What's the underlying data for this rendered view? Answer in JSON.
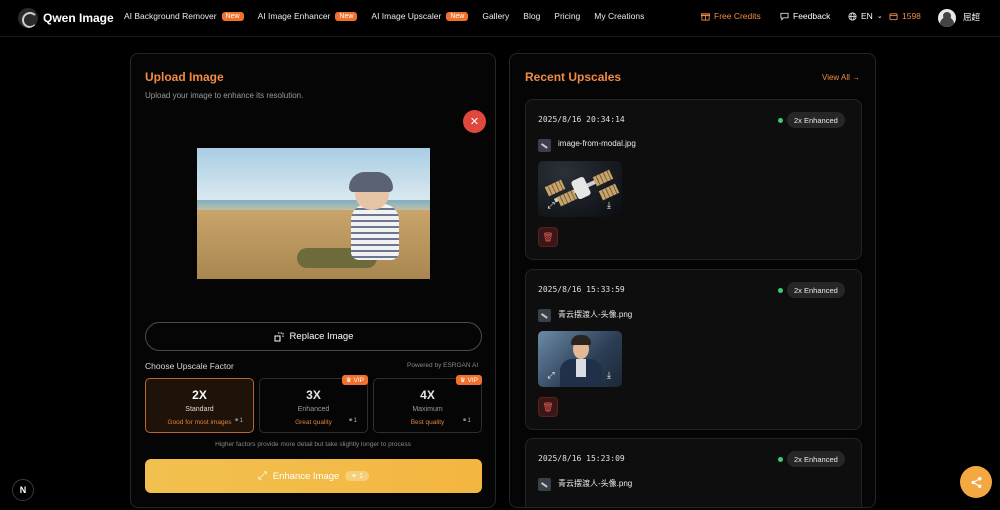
{
  "nav": {
    "logo_text": "Qwen Image",
    "links": [
      {
        "label": "AI Background Remover",
        "badge": "New"
      },
      {
        "label": "AI Image Enhancer",
        "badge": "New"
      },
      {
        "label": "AI Image Upscaler",
        "badge": "New"
      },
      {
        "label": "Gallery"
      },
      {
        "label": "Blog"
      },
      {
        "label": "Pricing"
      },
      {
        "label": "My Creations"
      }
    ],
    "free_credits": "Free Credits",
    "feedback": "Feedback",
    "language": "EN",
    "credits_count": "1598",
    "username": "屈超"
  },
  "upload": {
    "title": "Upload Image",
    "subtitle": "Upload your image to enhance its resolution.",
    "replace_label": "Replace Image",
    "factor_label": "Choose Upscale Factor",
    "powered_by": "Powered by ESRGAN AI",
    "factors": [
      {
        "value": "2X",
        "name": "Standard",
        "desc": "Good for most images",
        "cost": "1",
        "vip": "",
        "selected": true
      },
      {
        "value": "3X",
        "name": "Enhanced",
        "desc": "Great quality",
        "cost": "1",
        "vip": "VIP",
        "selected": false
      },
      {
        "value": "4X",
        "name": "Maximum",
        "desc": "Best quality",
        "cost": "1",
        "vip": "VIP",
        "selected": false
      }
    ],
    "hint": "Higher factors provide more detail but take slightly longer to process",
    "enhance_label": "Enhance Image",
    "enhance_cost": "1"
  },
  "recent": {
    "title": "Recent Upscales",
    "view_all": "View All →",
    "items": [
      {
        "time": "2025/8/16 20:34:14",
        "status": "2x Enhanced",
        "file": "image-from-modal.jpg"
      },
      {
        "time": "2025/8/16 15:33:59",
        "status": "2x Enhanced",
        "file": "青云摆渡人-头像.png"
      },
      {
        "time": "2025/8/16 15:23:09",
        "status": "2x Enhanced",
        "file": "青云摆渡人-头像.png"
      }
    ]
  },
  "colors": {
    "accent": "#f28b45",
    "danger": "#e0473e",
    "enhance": "#f2c04f",
    "status": "#3ccf6e"
  }
}
